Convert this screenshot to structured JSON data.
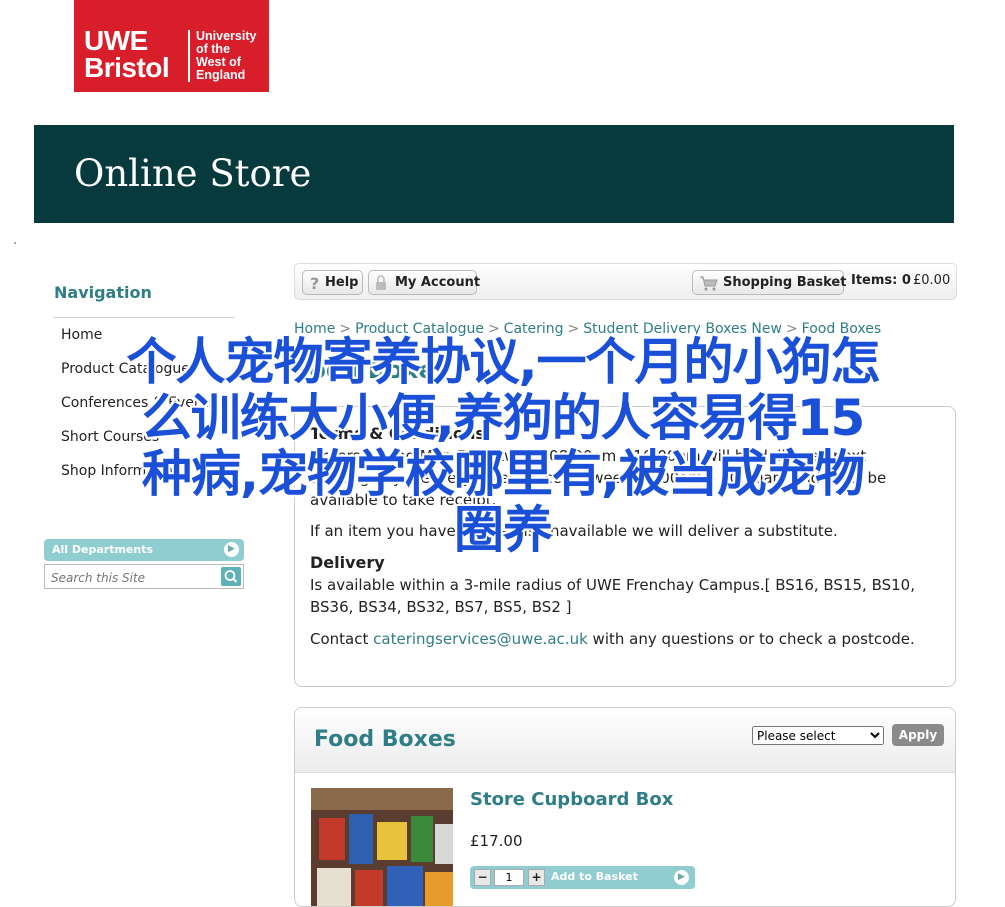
{
  "logo": {
    "wordmark_line1": "UWE",
    "wordmark_line2": "Bristol",
    "tagline_line1": "University",
    "tagline_line2": "of the",
    "tagline_line3": "West of",
    "tagline_line4": "England",
    "color": "#d81e2b"
  },
  "banner": {
    "title": "Online Store",
    "color": "#063a3d"
  },
  "sidebar": {
    "title": "Navigation",
    "items": [
      {
        "label": "Home"
      },
      {
        "label": "Product Catalogue"
      },
      {
        "label": "Conferences & Events"
      },
      {
        "label": "Short Courses"
      },
      {
        "label": "Shop Information"
      }
    ],
    "departments_label": "All Departments",
    "search_placeholder": "Search this Site"
  },
  "toolbar": {
    "help_label": "Help",
    "account_label": "My Account",
    "basket_label": "Shopping Basket",
    "items_label": "Items: 0",
    "items_amount": "£0.00"
  },
  "breadcrumb": {
    "items": [
      "Home",
      "Product Catalogue",
      "Catering",
      "Student Delivery Boxes New",
      "Food Boxes"
    ],
    "separator": ">"
  },
  "page_heading": "Food Boxes",
  "info": {
    "terms_heading": "Terms & Conditions",
    "terms_text": "Orders placed Mon-Fri between 08:00am – 16:00pm will be delivered next working day. Delivery takes place between 06:00am – 10:00am and must be available to take receipt.",
    "substitute_text": "If an item you have ordered is unavailable we will deliver a substitute.",
    "delivery_heading": "Delivery",
    "delivery_text": "Is available within a 3-mile radius of UWE Frenchay Campus.[ BS16, BS15, BS10, BS36, BS34, BS32, BS7, BS5, BS2 ]",
    "contact_prefix": "Contact ",
    "contact_email": "cateringservices@uwe.ac.uk",
    "contact_suffix": " with any questions or to check a postcode."
  },
  "food_boxes": {
    "title": "Food Boxes",
    "sort_selected": "Please select",
    "apply_label": "Apply",
    "products": [
      {
        "name": "Store Cupboard Box",
        "price": "£17.00",
        "quantity": "1",
        "add_label": "Add to Basket"
      }
    ]
  },
  "overlay": {
    "line1": "个人宠物寄养协议,一个月的小狗怎",
    "line2": "么训练大小便,养狗的人容易得15",
    "line3": "种病,宠物学校哪里有,被当成宠物",
    "line4": "圈养",
    "color": "#1a4fd8"
  },
  "accent_color": "#2f7e87"
}
